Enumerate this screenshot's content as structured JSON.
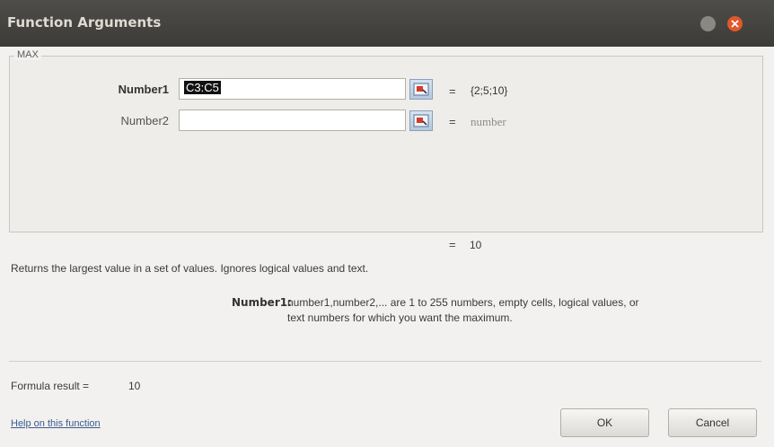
{
  "window": {
    "title": "Function Arguments"
  },
  "function_name": "MAX",
  "arguments": [
    {
      "label": "Number1",
      "value": "C3:C5",
      "result": "{2;5;10}"
    },
    {
      "label": "Number2",
      "value": "",
      "result": "number"
    }
  ],
  "equals": "=",
  "overall_result": "10",
  "description": "Returns the largest value in a set of values. Ignores logical values and text.",
  "arg_help": {
    "name": "Number1:",
    "line1": "number1,number2,... are 1 to 255 numbers, empty cells, logical values, or",
    "line2": "text numbers for which you want the maximum."
  },
  "formula_result": {
    "label": "Formula result =",
    "value": "10"
  },
  "help_link": "Help on this function",
  "buttons": {
    "ok": "OK",
    "cancel": "Cancel"
  },
  "colors": {
    "titlebar": "#3c3b37",
    "close": "#e0582b"
  }
}
